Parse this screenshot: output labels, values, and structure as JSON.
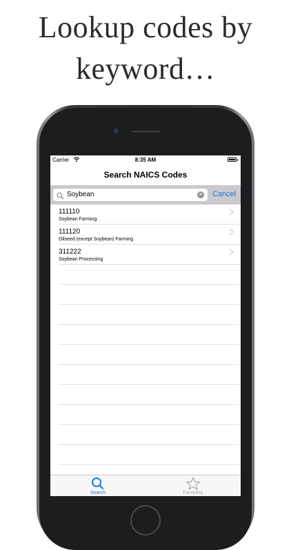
{
  "headline": {
    "line1": "Lookup codes by",
    "line2": "keyword…"
  },
  "status_bar": {
    "carrier": "Carrier",
    "time": "8:35 AM",
    "wifi_icon": "wifi-icon",
    "battery_icon": "battery-icon"
  },
  "nav": {
    "title": "Search NAICS Codes"
  },
  "search": {
    "query": "Soybean",
    "cancel_label": "Cancel",
    "search_icon": "magnifier-icon",
    "clear_icon": "clear-x-icon"
  },
  "results": [
    {
      "code": "111110",
      "description": "Soybean Farming"
    },
    {
      "code": "111120",
      "description": "Oilseed (except Soybean) Farming"
    },
    {
      "code": "311222",
      "description": "Soybean Processing"
    }
  ],
  "tabs": [
    {
      "label": "Search",
      "icon": "magnifier-icon",
      "selected": true
    },
    {
      "label": "Favorites",
      "icon": "star-icon",
      "selected": false
    }
  ],
  "colors": {
    "accent": "#1a7be0",
    "inactive_tab": "#a8a8ad",
    "search_bar_bg": "#c9c9ce"
  }
}
